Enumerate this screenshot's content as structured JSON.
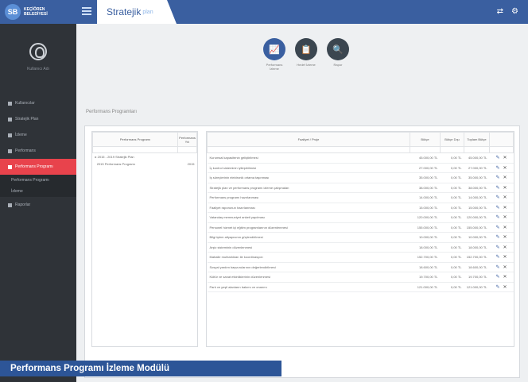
{
  "sidebar": {
    "logo_mark": "SB",
    "logo_line1": "KEÇİÖREN",
    "logo_line2": "BELEDİYESİ",
    "user_name": "Kullanıcı Adı",
    "menu": [
      {
        "label": "Kullanıcılar",
        "active": false
      },
      {
        "label": "Stratejik Plan",
        "active": false
      },
      {
        "label": "İzleme",
        "active": false
      },
      {
        "label": "Performans",
        "active": false
      },
      {
        "label": "Performans Programı",
        "active": true
      }
    ],
    "submenu": [
      "Performans Programı",
      "İzleme"
    ],
    "menu_extra": "Raporlar"
  },
  "topbar": {
    "brand": "Stratejik",
    "brand_suffix": "plan",
    "icons": [
      "share-icon",
      "settings-icon"
    ]
  },
  "actions": [
    {
      "label": "Performans İzleme",
      "icon": "chart-icon"
    },
    {
      "label": "Hedef İzleme",
      "icon": "clipboard-icon"
    },
    {
      "label": "Rapor",
      "icon": "document-search-icon"
    }
  ],
  "section_title": "Performans Programları",
  "left_table": {
    "headers": [
      "Performans Programı",
      "Performans Yılı"
    ],
    "rows": [
      {
        "name": "2015 - 2019 Stratejik Plan",
        "year": ""
      },
      {
        "name": "2015 Performans Programı",
        "year": "2015"
      }
    ]
  },
  "right_table": {
    "headers": [
      "Faaliyet / Proje",
      "Bütçe",
      "Bütçe Dışı",
      "Toplam Bütçe",
      ""
    ],
    "rows": [
      {
        "name": "Kurumsal kapasitenin geliştirilmesi",
        "budget": "45.000,00 TL",
        "extra": "0,00 TL",
        "total": "45.000,00 TL"
      },
      {
        "name": "İç kontrol sisteminin iyileştirilmesi",
        "budget": "27.000,00 TL",
        "extra": "0,00 TL",
        "total": "27.000,00 TL"
      },
      {
        "name": "İş süreçlerinin elektronik ortama taşınması",
        "budget": "35.000,00 TL",
        "extra": "0,00 TL",
        "total": "35.000,00 TL"
      },
      {
        "name": "Stratejik plan ve performans programı izleme çalışmaları",
        "budget": "38.000,00 TL",
        "extra": "0,00 TL",
        "total": "38.000,00 TL"
      },
      {
        "name": "Performans programı hazırlanması",
        "budget": "14.000,00 TL",
        "extra": "0,00 TL",
        "total": "14.000,00 TL"
      },
      {
        "name": "Faaliyet raporunun hazırlanması",
        "budget": "15.000,00 TL",
        "extra": "0,00 TL",
        "total": "15.000,00 TL"
      },
      {
        "name": "Vatandaş memnuniyet anketi yapılması",
        "budget": "120.000,00 TL",
        "extra": "0,00 TL",
        "total": "120.000,00 TL"
      },
      {
        "name": "Personel hizmet içi eğitim programlarının düzenlenmesi",
        "budget": "155.000,00 TL",
        "extra": "0,00 TL",
        "total": "155.000,00 TL"
      },
      {
        "name": "Bilgi işlem altyapısının güçlendirilmesi",
        "budget": "10.000,00 TL",
        "extra": "0,00 TL",
        "total": "10.000,00 TL"
      },
      {
        "name": "Arşiv sisteminin düzenlenmesi",
        "budget": "18.000,00 TL",
        "extra": "0,00 TL",
        "total": "18.000,00 TL"
      },
      {
        "name": "Mahalle muhtarlıkları ile koordinasyon",
        "budget": "152.700,00 TL",
        "extra": "0,00 TL",
        "total": "152.700,00 TL"
      },
      {
        "name": "Sosyal yardım başvurularının değerlendirilmesi",
        "budget": "18.600,00 TL",
        "extra": "0,00 TL",
        "total": "18.600,00 TL"
      },
      {
        "name": "Kültür ve sanat etkinliklerinin düzenlenmesi",
        "budget": "19.700,00 TL",
        "extra": "0,00 TL",
        "total": "19.700,00 TL"
      },
      {
        "name": "Park ve yeşil alanların bakımı ve onarımı",
        "budget": "121.000,00 TL",
        "extra": "0,00 TL",
        "total": "121.000,00 TL"
      }
    ]
  },
  "caption": "Performans Programı İzleme Modülü"
}
